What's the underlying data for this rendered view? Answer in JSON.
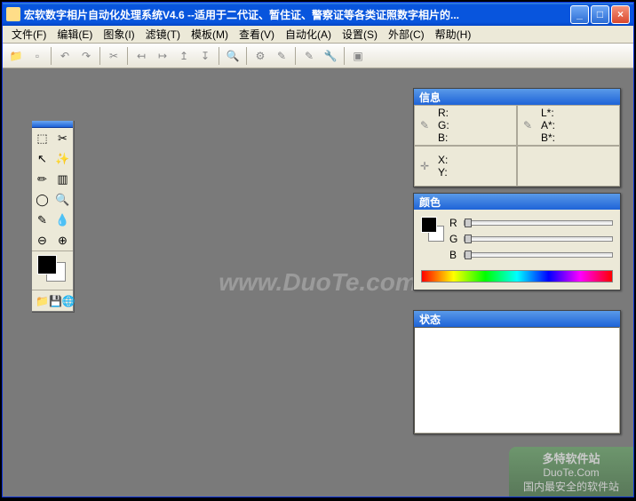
{
  "window": {
    "title": "宏软数字相片自动化处理系统V4.6  --适用于二代证、暂住证、警察证等各类证照数字相片的..."
  },
  "menus": {
    "file": "文件(F)",
    "edit": "编辑(E)",
    "image": "图象(I)",
    "filter": "滤镜(T)",
    "template": "模板(M)",
    "view": "查看(V)",
    "automation": "自动化(A)",
    "settings": "设置(S)",
    "external": "外部(C)",
    "help": "帮助(H)"
  },
  "toolbar": {
    "open": "📁",
    "new": "▫",
    "back": "↶",
    "forward": "↷",
    "cut": "✂",
    "left": "↤",
    "right": "↦",
    "up": "↥",
    "down": "↧",
    "zoom": "🔍",
    "tool1": "⚙",
    "tool2": "✎",
    "tool3": "✎",
    "tool4": "🔧",
    "tool5": "▣"
  },
  "toolbox": {
    "tools": [
      "⬚",
      "✂",
      "↖",
      "✨",
      "✏",
      "▥",
      "◯",
      "🔍",
      "✎",
      "💧",
      "⊖",
      "⊕"
    ],
    "actions": [
      "📁",
      "💾",
      "🌐"
    ]
  },
  "panels": {
    "info": {
      "title": "信息",
      "rgb": {
        "r": "R:",
        "g": "G:",
        "b": "B:"
      },
      "lab": {
        "l": "L*:",
        "a": "A*:",
        "b": "B*:"
      },
      "xy": {
        "x": "X:",
        "y": "Y:"
      }
    },
    "color": {
      "title": "颜色",
      "r": "R",
      "g": "G",
      "b": "B"
    },
    "status": {
      "title": "状态"
    }
  },
  "watermark": "www.DuoTe.com",
  "badge": {
    "name": "多特软件站",
    "url": "DuoTe.Com",
    "slogan": "国内最安全的软件站"
  }
}
